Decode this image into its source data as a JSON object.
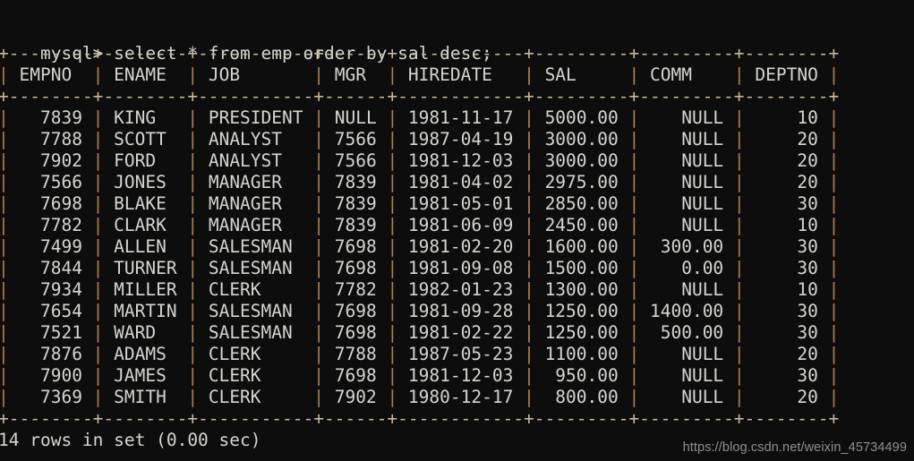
{
  "terminal": {
    "background_color": "#0d0d0d",
    "text_color": "#d5d5d0",
    "rule_color": "#c9b89a",
    "pipe_color": "#b08050",
    "prompt": "mysql> ",
    "command": "select * from emp order by sal desc;",
    "prompt_line": "mysql> select * from emp order by sal desc;",
    "status_line": "14 rows in set (0.00 sec)"
  },
  "watermark": {
    "text": "https://blog.csdn.net/weixin_45734499"
  },
  "table": {
    "border_line": "+--------+--------+-----------+------+------------+---------+---------+--------+",
    "columns": [
      {
        "name": "EMPNO",
        "width": 8,
        "align": "right"
      },
      {
        "name": "ENAME",
        "width": 8,
        "align": "left"
      },
      {
        "name": "JOB",
        "width": 11,
        "align": "left"
      },
      {
        "name": "MGR",
        "width": 6,
        "align": "right"
      },
      {
        "name": "HIREDATE",
        "width": 12,
        "align": "left"
      },
      {
        "name": "SAL",
        "width": 9,
        "align": "right"
      },
      {
        "name": "COMM",
        "width": 9,
        "align": "right"
      },
      {
        "name": "DEPTNO",
        "width": 8,
        "align": "right"
      }
    ],
    "header_line": "| EMPNO  | ENAME  | JOB       | MGR  | HIREDATE   | SAL     | COMM    | DEPTNO |",
    "row_count": 14,
    "rows": [
      {
        "EMPNO": "7839",
        "ENAME": "KING",
        "JOB": "PRESIDENT",
        "MGR": "NULL",
        "HIREDATE": "1981-11-17",
        "SAL": "5000.00",
        "COMM": "NULL",
        "DEPTNO": "10"
      },
      {
        "EMPNO": "7788",
        "ENAME": "SCOTT",
        "JOB": "ANALYST",
        "MGR": "7566",
        "HIREDATE": "1987-04-19",
        "SAL": "3000.00",
        "COMM": "NULL",
        "DEPTNO": "20"
      },
      {
        "EMPNO": "7902",
        "ENAME": "FORD",
        "JOB": "ANALYST",
        "MGR": "7566",
        "HIREDATE": "1981-12-03",
        "SAL": "3000.00",
        "COMM": "NULL",
        "DEPTNO": "20"
      },
      {
        "EMPNO": "7566",
        "ENAME": "JONES",
        "JOB": "MANAGER",
        "MGR": "7839",
        "HIREDATE": "1981-04-02",
        "SAL": "2975.00",
        "COMM": "NULL",
        "DEPTNO": "20"
      },
      {
        "EMPNO": "7698",
        "ENAME": "BLAKE",
        "JOB": "MANAGER",
        "MGR": "7839",
        "HIREDATE": "1981-05-01",
        "SAL": "2850.00",
        "COMM": "NULL",
        "DEPTNO": "30"
      },
      {
        "EMPNO": "7782",
        "ENAME": "CLARK",
        "JOB": "MANAGER",
        "MGR": "7839",
        "HIREDATE": "1981-06-09",
        "SAL": "2450.00",
        "COMM": "NULL",
        "DEPTNO": "10"
      },
      {
        "EMPNO": "7499",
        "ENAME": "ALLEN",
        "JOB": "SALESMAN",
        "MGR": "7698",
        "HIREDATE": "1981-02-20",
        "SAL": "1600.00",
        "COMM": "300.00",
        "DEPTNO": "30"
      },
      {
        "EMPNO": "7844",
        "ENAME": "TURNER",
        "JOB": "SALESMAN",
        "MGR": "7698",
        "HIREDATE": "1981-09-08",
        "SAL": "1500.00",
        "COMM": "0.00",
        "DEPTNO": "30"
      },
      {
        "EMPNO": "7934",
        "ENAME": "MILLER",
        "JOB": "CLERK",
        "MGR": "7782",
        "HIREDATE": "1982-01-23",
        "SAL": "1300.00",
        "COMM": "NULL",
        "DEPTNO": "10"
      },
      {
        "EMPNO": "7654",
        "ENAME": "MARTIN",
        "JOB": "SALESMAN",
        "MGR": "7698",
        "HIREDATE": "1981-09-28",
        "SAL": "1250.00",
        "COMM": "1400.00",
        "DEPTNO": "30"
      },
      {
        "EMPNO": "7521",
        "ENAME": "WARD",
        "JOB": "SALESMAN",
        "MGR": "7698",
        "HIREDATE": "1981-02-22",
        "SAL": "1250.00",
        "COMM": "500.00",
        "DEPTNO": "30"
      },
      {
        "EMPNO": "7876",
        "ENAME": "ADAMS",
        "JOB": "CLERK",
        "MGR": "7788",
        "HIREDATE": "1987-05-23",
        "SAL": "1100.00",
        "COMM": "NULL",
        "DEPTNO": "20"
      },
      {
        "EMPNO": "7900",
        "ENAME": "JAMES",
        "JOB": "CLERK",
        "MGR": "7698",
        "HIREDATE": "1981-12-03",
        "SAL": "950.00",
        "COMM": "NULL",
        "DEPTNO": "30"
      },
      {
        "EMPNO": "7369",
        "ENAME": "SMITH",
        "JOB": "CLERK",
        "MGR": "7902",
        "HIREDATE": "1980-12-17",
        "SAL": "800.00",
        "COMM": "NULL",
        "DEPTNO": "20"
      }
    ]
  }
}
